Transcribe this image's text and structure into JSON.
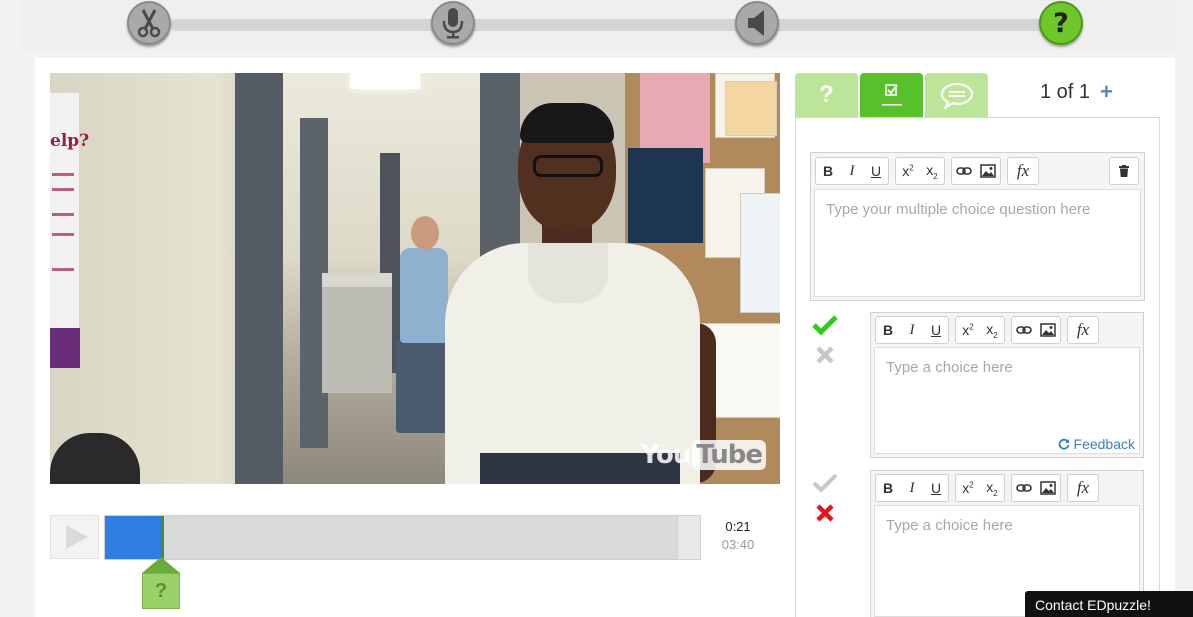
{
  "steps": [
    {
      "name": "cut",
      "icon": "scissors-icon"
    },
    {
      "name": "voiceover",
      "icon": "microphone-icon"
    },
    {
      "name": "audio-notes",
      "icon": "speaker-icon"
    },
    {
      "name": "quiz",
      "icon": "question-icon",
      "label": "?",
      "active": true
    }
  ],
  "video": {
    "watermark_you": "You",
    "watermark_tube": "Tube",
    "poster_text": "elp?"
  },
  "player": {
    "current_time": "0:21",
    "total_time": "03:40",
    "progress_fraction": 0.0955,
    "marker_label": "?"
  },
  "editor": {
    "tabs": [
      {
        "name": "open-ended",
        "label": "?"
      },
      {
        "name": "multiple-choice",
        "icon": "checkbox-icon",
        "active": true
      },
      {
        "name": "comment",
        "icon": "speech-bubble-icon"
      }
    ],
    "counter": "1 of 1",
    "add_label": "+",
    "question_placeholder": "Type your multiple choice question here",
    "choices": [
      {
        "placeholder": "Type a choice here",
        "correct": true,
        "feedback_label": "Feedback"
      },
      {
        "placeholder": "Type a choice here",
        "correct": false
      }
    ],
    "toolbar": {
      "bold": "B",
      "italic": "I",
      "underline": "U",
      "formula": "fx"
    }
  },
  "contact": {
    "label": "Contact EDpuzzle!"
  },
  "colors": {
    "accent_green": "#58c02a",
    "light_green": "#bde59a",
    "progress_blue": "#2f7de0",
    "correct_green": "#2ecc1a",
    "wrong_red": "#e8141b",
    "link_blue": "#3a7ec4"
  }
}
